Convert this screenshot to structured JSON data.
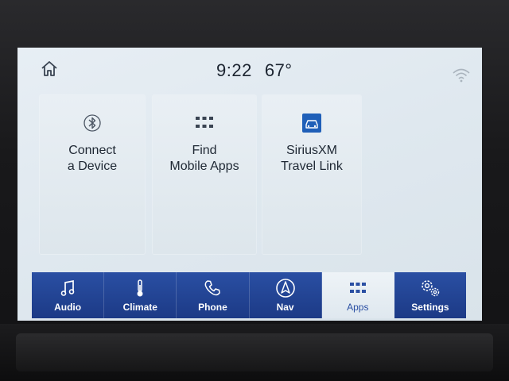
{
  "status": {
    "time": "9:22",
    "temperature": "67°"
  },
  "apps": [
    {
      "label_line1": "Connect",
      "label_line2": "a Device",
      "icon": "bluetooth-icon"
    },
    {
      "label_line1": "Find",
      "label_line2": "Mobile Apps",
      "icon": "grid-icon"
    },
    {
      "label_line1": "SiriusXM",
      "label_line2": "Travel Link",
      "icon": "car-icon"
    }
  ],
  "nav": {
    "items": [
      {
        "label": "Audio",
        "icon": "music-note-icon"
      },
      {
        "label": "Climate",
        "icon": "thermometer-icon"
      },
      {
        "label": "Phone",
        "icon": "phone-icon"
      },
      {
        "label": "Nav",
        "icon": "compass-icon"
      },
      {
        "label": "Apps",
        "icon": "grid-icon",
        "active": true
      },
      {
        "label": "Settings",
        "icon": "gear-icon"
      }
    ]
  },
  "colors": {
    "nav_bar": "#2a4fa3",
    "active_tab_text": "#2a4fa3",
    "screen_bg": "#e3ebf1",
    "sirius_badge": "#1f5fb8"
  }
}
